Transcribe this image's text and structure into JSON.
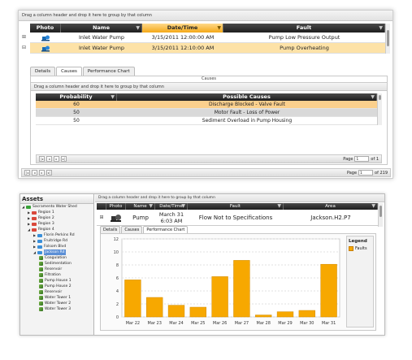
{
  "top": {
    "group_hint": "Drag a column header and drop it here to group by that column",
    "columns": [
      "Photo",
      "Name",
      "Date/Time",
      "Fault"
    ],
    "rows": [
      {
        "expander": "⊞",
        "name": "Inlet Water Pump",
        "datetime": "3/15/2011 12:00:00 AM",
        "fault": "Pump Low Pressure Output"
      },
      {
        "expander": "⊟",
        "name": "Inlet Water Pump",
        "datetime": "3/15/2011 12:10:00 AM",
        "fault": "Pump Overheating"
      }
    ],
    "tabs": [
      "Details",
      "Causes",
      "Performance Chart"
    ],
    "causes": {
      "title": "Causes",
      "group_hint": "Drag a column header and drop it here to group by that column",
      "columns": [
        "Probability",
        "Possible Causes"
      ],
      "rows": [
        {
          "prob": "60",
          "cause": "Discharge Blocked - Valve Fault"
        },
        {
          "prob": "50",
          "cause": "Motor Fault - Loss of Power"
        },
        {
          "prob": "50",
          "cause": "Sediment Overload in Pump Housing"
        }
      ],
      "pager": {
        "page_label": "Page",
        "page_value": "1",
        "of_label": "of 1"
      }
    },
    "pager": {
      "page_label": "Page",
      "page_value": "1",
      "of_label": "of 219"
    }
  },
  "bottom": {
    "assets_title": "Assets",
    "tree": [
      {
        "label": "Sacramento Water Shed",
        "level": 0,
        "kind": "root"
      },
      {
        "label": "Region 1",
        "level": 1,
        "kind": "region"
      },
      {
        "label": "Region 2",
        "level": 1,
        "kind": "region"
      },
      {
        "label": "Region 3",
        "level": 1,
        "kind": "region"
      },
      {
        "label": "Region 4",
        "level": 1,
        "kind": "region"
      },
      {
        "label": "Florin Perkins Rd",
        "level": 2,
        "kind": "site"
      },
      {
        "label": "Fruitridge Rd",
        "level": 2,
        "kind": "site"
      },
      {
        "label": "Folsom Blvd",
        "level": 2,
        "kind": "site"
      },
      {
        "label": "Jackson Rd",
        "level": 2,
        "kind": "site",
        "selected": true
      },
      {
        "label": "Coagulation",
        "level": 3,
        "kind": "leaf"
      },
      {
        "label": "Sedimentation",
        "level": 3,
        "kind": "leaf"
      },
      {
        "label": "Reservoir",
        "level": 3,
        "kind": "leaf"
      },
      {
        "label": "Filtration",
        "level": 3,
        "kind": "leaf"
      },
      {
        "label": "Pump House 1",
        "level": 3,
        "kind": "leaf"
      },
      {
        "label": "Pump House 2",
        "level": 3,
        "kind": "leaf"
      },
      {
        "label": "Reservoir",
        "level": 3,
        "kind": "leaf"
      },
      {
        "label": "Water Tower 1",
        "level": 3,
        "kind": "leaf"
      },
      {
        "label": "Water Tower 2",
        "level": 3,
        "kind": "leaf"
      },
      {
        "label": "Water Tower 3",
        "level": 3,
        "kind": "leaf"
      }
    ],
    "group_hint": "Drag a column header and drop it here to group by that column",
    "columns": [
      "Photo",
      "Name",
      "Date/Time",
      "Fault",
      "Area"
    ],
    "row": {
      "expander": "⊞",
      "name": "Pump",
      "date": "March 31",
      "time": "6:03 AM",
      "fault": "Flow Not to Specifications",
      "area": "Jackson.H2.P7"
    },
    "tabs": [
      "Details",
      "Causes",
      "Performance Chart"
    ],
    "legend_title": "Legend",
    "colors": {
      "accent": "#f4a818",
      "bar": "#f7a800",
      "header_dark": "#2a2a2a",
      "selection": "#fde2a7",
      "tree_selected": "#5b8fd6"
    }
  },
  "chart_data": {
    "type": "bar",
    "categories": [
      "Mar 22",
      "Mar 23",
      "Mar 24",
      "Mar 25",
      "Mar 26",
      "Mar 27",
      "Mar 28",
      "Mar 29",
      "Mar 30",
      "Mar 31"
    ],
    "series": [
      {
        "name": "Faults",
        "values": [
          5.7,
          3.0,
          1.8,
          1.5,
          6.2,
          8.7,
          0.3,
          0.8,
          1.0,
          8.1
        ]
      }
    ],
    "yticks": [
      0,
      2,
      4,
      6,
      8,
      10,
      12
    ],
    "ylim": [
      0,
      12
    ],
    "grid": true,
    "legend": "right"
  }
}
